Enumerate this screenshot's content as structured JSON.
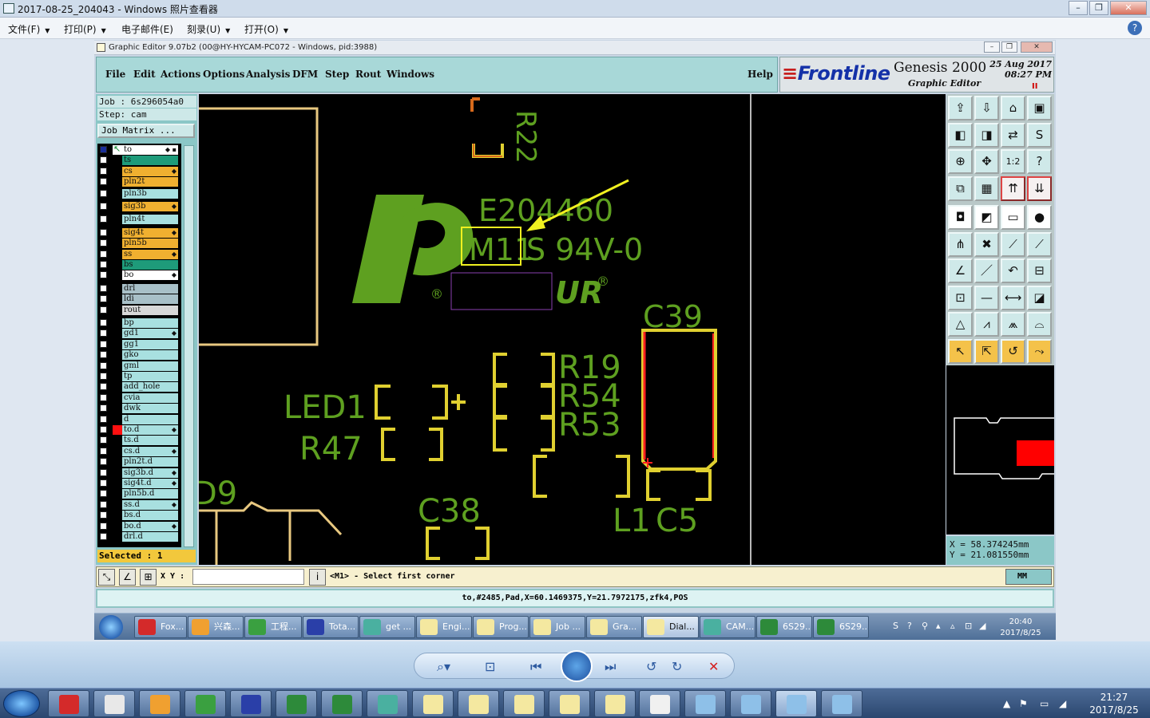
{
  "viewer": {
    "title": "2017-08-25_204043 - Windows 照片查看器",
    "menu": [
      {
        "label": "文件(F)"
      },
      {
        "label": "打印(P)"
      },
      {
        "label": "电子邮件(E)"
      },
      {
        "label": "刻录(U)"
      },
      {
        "label": "打开(O)"
      }
    ],
    "help_icon": "?"
  },
  "genesis": {
    "title": "Graphic Editor 9.07b2 (00@HY-HYCAM-PC072 - Windows, pid:3988)",
    "menu": [
      "File",
      "Edit",
      "Actions",
      "Options",
      "Analysis",
      "DFM",
      "Step",
      "Rout",
      "Windows"
    ],
    "help": "Help",
    "logo": {
      "brand": "Frontline",
      "product": "Genesis 2000",
      "subtitle": "Graphic Editor",
      "date": "25 Aug 2017",
      "time": "08:27 PM",
      "pause": "II"
    },
    "job": "Job : 6s296054a0",
    "step": "Step: cam",
    "job_matrix": "Job Matrix ...",
    "layers": [
      {
        "name": "to",
        "color": "#ffffff",
        "ind": "green",
        "check": true,
        "mark": "◆ ▪"
      },
      {
        "name": "ts",
        "color": "#1e9b7a",
        "ind": "",
        "check": false,
        "mark": ""
      },
      {
        "name": "cs",
        "color": "#f0b030",
        "ind": "",
        "check": false,
        "mark": "◆"
      },
      {
        "name": "pln2t",
        "color": "#f0b030",
        "ind": "",
        "check": false,
        "mark": ""
      },
      {
        "name": "pln3b",
        "color": "#a8e0e0",
        "ind": "",
        "check": false,
        "mark": ""
      },
      {
        "name": "sig3b",
        "color": "#f0b030",
        "ind": "",
        "check": false,
        "mark": "◆"
      },
      {
        "name": "pln4t",
        "color": "#a8e0e0",
        "ind": "",
        "check": false,
        "mark": ""
      },
      {
        "name": "sig4t",
        "color": "#f0b030",
        "ind": "",
        "check": false,
        "mark": "◆"
      },
      {
        "name": "pln5b",
        "color": "#f0b030",
        "ind": "",
        "check": false,
        "mark": ""
      },
      {
        "name": "ss",
        "color": "#f0b030",
        "ind": "",
        "check": false,
        "mark": "◆"
      },
      {
        "name": "bs",
        "color": "#1e9b7a",
        "ind": "",
        "check": false,
        "mark": ""
      },
      {
        "name": "bo",
        "color": "#ffffff",
        "ind": "",
        "check": false,
        "mark": "◆"
      },
      {
        "name": "drl",
        "color": "#a8c0c8",
        "ind": "",
        "check": false,
        "mark": ""
      },
      {
        "name": "ldi",
        "color": "#a8c0c8",
        "ind": "",
        "check": false,
        "mark": ""
      },
      {
        "name": "rout",
        "color": "#d8d8d8",
        "ind": "",
        "check": false,
        "mark": ""
      },
      {
        "name": "bp",
        "color": "#a8e0e0",
        "ind": "",
        "check": false,
        "mark": ""
      },
      {
        "name": "gd1",
        "color": "#a8e0e0",
        "ind": "",
        "check": false,
        "mark": "◆"
      },
      {
        "name": "gg1",
        "color": "#a8e0e0",
        "ind": "",
        "check": false,
        "mark": ""
      },
      {
        "name": "gko",
        "color": "#a8e0e0",
        "ind": "",
        "check": false,
        "mark": ""
      },
      {
        "name": "gml",
        "color": "#a8e0e0",
        "ind": "",
        "check": false,
        "mark": ""
      },
      {
        "name": "tp",
        "color": "#a8e0e0",
        "ind": "",
        "check": false,
        "mark": ""
      },
      {
        "name": "add_hole",
        "color": "#a8e0e0",
        "ind": "",
        "check": false,
        "mark": ""
      },
      {
        "name": "cvia",
        "color": "#a8e0e0",
        "ind": "",
        "check": false,
        "mark": ""
      },
      {
        "name": "dwk",
        "color": "#a8e0e0",
        "ind": "",
        "check": false,
        "mark": ""
      },
      {
        "name": "d",
        "color": "#a8e0e0",
        "ind": "",
        "check": false,
        "mark": ""
      },
      {
        "name": "to.d",
        "color": "#a8e0e0",
        "ind": "red",
        "check": false,
        "mark": "◆"
      },
      {
        "name": "ts.d",
        "color": "#a8e0e0",
        "ind": "",
        "check": false,
        "mark": ""
      },
      {
        "name": "cs.d",
        "color": "#a8e0e0",
        "ind": "",
        "check": false,
        "mark": "◆"
      },
      {
        "name": "pln2t.d",
        "color": "#a8e0e0",
        "ind": "",
        "check": false,
        "mark": ""
      },
      {
        "name": "sig3b.d",
        "color": "#a8e0e0",
        "ind": "",
        "check": false,
        "mark": "◆"
      },
      {
        "name": "sig4t.d",
        "color": "#a8e0e0",
        "ind": "",
        "check": false,
        "mark": "◆"
      },
      {
        "name": "pln5b.d",
        "color": "#a8e0e0",
        "ind": "",
        "check": false,
        "mark": ""
      },
      {
        "name": "ss.d",
        "color": "#a8e0e0",
        "ind": "",
        "check": false,
        "mark": "◆"
      },
      {
        "name": "bs.d",
        "color": "#a8e0e0",
        "ind": "",
        "check": false,
        "mark": ""
      },
      {
        "name": "bo.d",
        "color": "#a8e0e0",
        "ind": "",
        "check": false,
        "mark": "◆"
      },
      {
        "name": "drl.d",
        "color": "#a8e0e0",
        "ind": "",
        "check": false,
        "mark": ""
      }
    ],
    "selected": "Selected : 1",
    "canvas_labels": {
      "r22": "R22",
      "e204460": "E204460",
      "m11": "M11",
      "s94v0": "S 94V-0",
      "c39": "C39",
      "r19": "R19",
      "r54": "R54",
      "r53": "R53",
      "led1": "LED1",
      "r47": "R47",
      "d9": "D9",
      "c38": "C38",
      "l1": "L1",
      "c5": "C5",
      "reg1": "®",
      "reg2": "®",
      "ur": "UR"
    },
    "coords": {
      "x": "X = 58.374245mm",
      "y": "Y = 21.081550mm"
    },
    "xy_label": "X Y :",
    "xy_value": "",
    "prompt": "<M1> - Select first corner",
    "units": "MM",
    "status": "to,#2485,Pad,X=60.1469375,Y=21.7972175,zfk4,POS",
    "toolbar_icons": [
      "open-icon",
      "save-icon",
      "home-icon",
      "window-icon",
      "pan-left-icon",
      "pan-right-icon",
      "swap-icon",
      "snap-icon",
      "zoom-fit-icon",
      "zoom-center-icon",
      "scale-1-2-icon",
      "query-icon",
      "copy-icon",
      "grid-icon",
      "layers-up-icon",
      "layers-down-icon",
      "pad-icon",
      "draw-icon",
      "measure-icon",
      "dot-icon",
      "connect-icon",
      "delete-icon",
      "line-node-icon",
      "node-icon",
      "slope-icon",
      "diagonal-icon",
      "arc-icon",
      "dfm-icon",
      "add-node-icon",
      "line-icon",
      "stretch-icon",
      "union-icon",
      "triangle-icon",
      "vertex-icon",
      "arc-tool-icon",
      "round-icon",
      "select-icon",
      "select-box-icon",
      "select-rot-icon",
      "route-icon"
    ]
  },
  "inner_taskbar": {
    "items": [
      "Fox...",
      "兴森...",
      "工程...",
      "Tota...",
      "get ...",
      "Engi...",
      "Prog...",
      "Job ...",
      "Gra...",
      "Dial...",
      "CAM...",
      "6S29...",
      "6S29..."
    ],
    "time": "20:40",
    "date": "2017/8/25"
  },
  "taskbar": {
    "time": "21:27",
    "date": "2017/8/25"
  },
  "colors": {
    "silk": "#5ea020",
    "pad_yellow": "#e0d030",
    "pad_orange": "#d86a1c",
    "highlight": "#ff2020",
    "arrow": "#f0f020",
    "board": "#e8c880"
  }
}
